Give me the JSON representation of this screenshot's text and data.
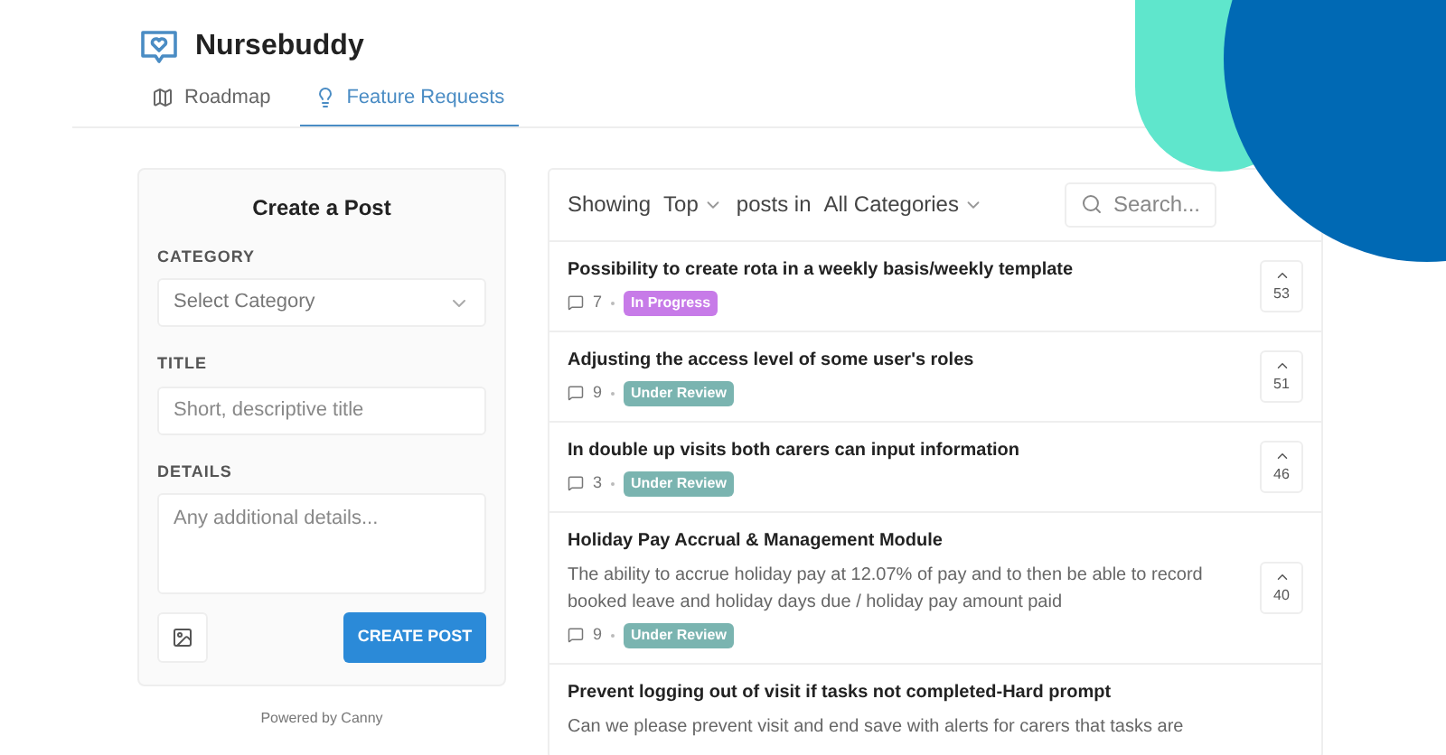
{
  "brand": {
    "name": "Nursebuddy"
  },
  "tabs": [
    {
      "label": "Roadmap",
      "selected": false,
      "kind": "map"
    },
    {
      "label": "Feature Requests",
      "selected": true,
      "kind": "bulb"
    }
  ],
  "create_post": {
    "title": "Create a Post",
    "category_label": "CATEGORY",
    "category_placeholder": "Select Category",
    "title_label": "TITLE",
    "title_placeholder": "Short, descriptive title",
    "details_label": "DETAILS",
    "details_placeholder": "Any additional details...",
    "submit": "CREATE POST"
  },
  "powered_by": "Powered by Canny",
  "filter": {
    "showing": "Showing",
    "sort": "Top",
    "posts_in": "posts in",
    "category": "All Categories",
    "search_placeholder": "Search..."
  },
  "posts": [
    {
      "title": "Possibility to create rota in a weekly basis/weekly template",
      "comments": "7",
      "status": "In Progress",
      "color": "#c77be8",
      "votes": "53"
    },
    {
      "title": "Adjusting the access level of some user's roles",
      "comments": "9",
      "status": "Under Review",
      "color": "#7ab4b0",
      "votes": "51"
    },
    {
      "title": "In double up visits both carers can input information",
      "comments": "3",
      "status": "Under Review",
      "color": "#7ab4b0",
      "votes": "46"
    },
    {
      "title": "Holiday Pay Accrual & Management Module",
      "description": "The ability to accrue holiday pay at 12.07% of pay and to then be able to record booked leave and holiday days due / holiday pay amount paid",
      "comments": "9",
      "status": "Under Review",
      "color": "#7ab4b0",
      "votes": "40"
    },
    {
      "title": "Prevent logging out of visit if tasks not completed-Hard prompt",
      "description": "Can we please prevent visit and end save with alerts for carers that tasks are"
    }
  ]
}
